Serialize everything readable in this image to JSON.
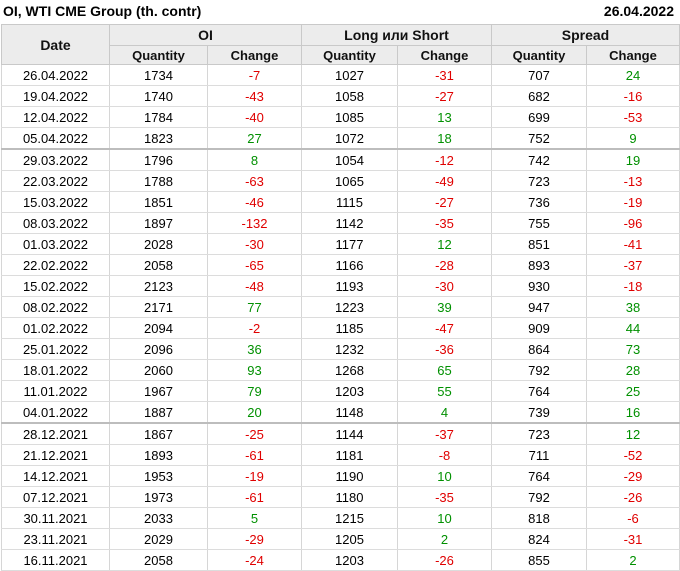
{
  "header": {
    "title": "OI, WTI CME Group (th. contr)",
    "date": "26.04.2022"
  },
  "columns": {
    "date": "Date",
    "groups": [
      "OI",
      "Long или Short",
      "Spread"
    ],
    "sub": [
      "Quantity",
      "Change",
      "Quantity",
      "Change",
      "Quantity",
      "Change"
    ]
  },
  "rows": [
    {
      "date": "26.04.2022",
      "oi_q": "1734",
      "oi_c": "-7",
      "ls_q": "1027",
      "ls_c": "-31",
      "sp_q": "707",
      "sp_c": "24",
      "sep": false
    },
    {
      "date": "19.04.2022",
      "oi_q": "1740",
      "oi_c": "-43",
      "ls_q": "1058",
      "ls_c": "-27",
      "sp_q": "682",
      "sp_c": "-16",
      "sep": false
    },
    {
      "date": "12.04.2022",
      "oi_q": "1784",
      "oi_c": "-40",
      "ls_q": "1085",
      "ls_c": "13",
      "sp_q": "699",
      "sp_c": "-53",
      "sep": false
    },
    {
      "date": "05.04.2022",
      "oi_q": "1823",
      "oi_c": "27",
      "ls_q": "1072",
      "ls_c": "18",
      "sp_q": "752",
      "sp_c": "9",
      "sep": false
    },
    {
      "date": "29.03.2022",
      "oi_q": "1796",
      "oi_c": "8",
      "ls_q": "1054",
      "ls_c": "-12",
      "sp_q": "742",
      "sp_c": "19",
      "sep": true
    },
    {
      "date": "22.03.2022",
      "oi_q": "1788",
      "oi_c": "-63",
      "ls_q": "1065",
      "ls_c": "-49",
      "sp_q": "723",
      "sp_c": "-13",
      "sep": false
    },
    {
      "date": "15.03.2022",
      "oi_q": "1851",
      "oi_c": "-46",
      "ls_q": "1115",
      "ls_c": "-27",
      "sp_q": "736",
      "sp_c": "-19",
      "sep": false
    },
    {
      "date": "08.03.2022",
      "oi_q": "1897",
      "oi_c": "-132",
      "ls_q": "1142",
      "ls_c": "-35",
      "sp_q": "755",
      "sp_c": "-96",
      "sep": false
    },
    {
      "date": "01.03.2022",
      "oi_q": "2028",
      "oi_c": "-30",
      "ls_q": "1177",
      "ls_c": "12",
      "sp_q": "851",
      "sp_c": "-41",
      "sep": false
    },
    {
      "date": "22.02.2022",
      "oi_q": "2058",
      "oi_c": "-65",
      "ls_q": "1166",
      "ls_c": "-28",
      "sp_q": "893",
      "sp_c": "-37",
      "sep": false
    },
    {
      "date": "15.02.2022",
      "oi_q": "2123",
      "oi_c": "-48",
      "ls_q": "1193",
      "ls_c": "-30",
      "sp_q": "930",
      "sp_c": "-18",
      "sep": false
    },
    {
      "date": "08.02.2022",
      "oi_q": "2171",
      "oi_c": "77",
      "ls_q": "1223",
      "ls_c": "39",
      "sp_q": "947",
      "sp_c": "38",
      "sep": false
    },
    {
      "date": "01.02.2022",
      "oi_q": "2094",
      "oi_c": "-2",
      "ls_q": "1185",
      "ls_c": "-47",
      "sp_q": "909",
      "sp_c": "44",
      "sep": false
    },
    {
      "date": "25.01.2022",
      "oi_q": "2096",
      "oi_c": "36",
      "ls_q": "1232",
      "ls_c": "-36",
      "sp_q": "864",
      "sp_c": "73",
      "sep": false
    },
    {
      "date": "18.01.2022",
      "oi_q": "2060",
      "oi_c": "93",
      "ls_q": "1268",
      "ls_c": "65",
      "sp_q": "792",
      "sp_c": "28",
      "sep": false
    },
    {
      "date": "11.01.2022",
      "oi_q": "1967",
      "oi_c": "79",
      "ls_q": "1203",
      "ls_c": "55",
      "sp_q": "764",
      "sp_c": "25",
      "sep": false
    },
    {
      "date": "04.01.2022",
      "oi_q": "1887",
      "oi_c": "20",
      "ls_q": "1148",
      "ls_c": "4",
      "sp_q": "739",
      "sp_c": "16",
      "sep": false
    },
    {
      "date": "28.12.2021",
      "oi_q": "1867",
      "oi_c": "-25",
      "ls_q": "1144",
      "ls_c": "-37",
      "sp_q": "723",
      "sp_c": "12",
      "sep": true
    },
    {
      "date": "21.12.2021",
      "oi_q": "1893",
      "oi_c": "-61",
      "ls_q": "1181",
      "ls_c": "-8",
      "sp_q": "711",
      "sp_c": "-52",
      "sep": false
    },
    {
      "date": "14.12.2021",
      "oi_q": "1953",
      "oi_c": "-19",
      "ls_q": "1190",
      "ls_c": "10",
      "sp_q": "764",
      "sp_c": "-29",
      "sep": false
    },
    {
      "date": "07.12.2021",
      "oi_q": "1973",
      "oi_c": "-61",
      "ls_q": "1180",
      "ls_c": "-35",
      "sp_q": "792",
      "sp_c": "-26",
      "sep": false
    },
    {
      "date": "30.11.2021",
      "oi_q": "2033",
      "oi_c": "5",
      "ls_q": "1215",
      "ls_c": "10",
      "sp_q": "818",
      "sp_c": "-6",
      "sep": false
    },
    {
      "date": "23.11.2021",
      "oi_q": "2029",
      "oi_c": "-29",
      "ls_q": "1205",
      "ls_c": "2",
      "sp_q": "824",
      "sp_c": "-31",
      "sep": false
    },
    {
      "date": "16.11.2021",
      "oi_q": "2058",
      "oi_c": "-24",
      "ls_q": "1203",
      "ls_c": "-26",
      "sp_q": "855",
      "sp_c": "2",
      "sep": false
    }
  ],
  "colors": {
    "negative": "#e00000",
    "positive": "#009000",
    "header_bg": "#ececec"
  }
}
